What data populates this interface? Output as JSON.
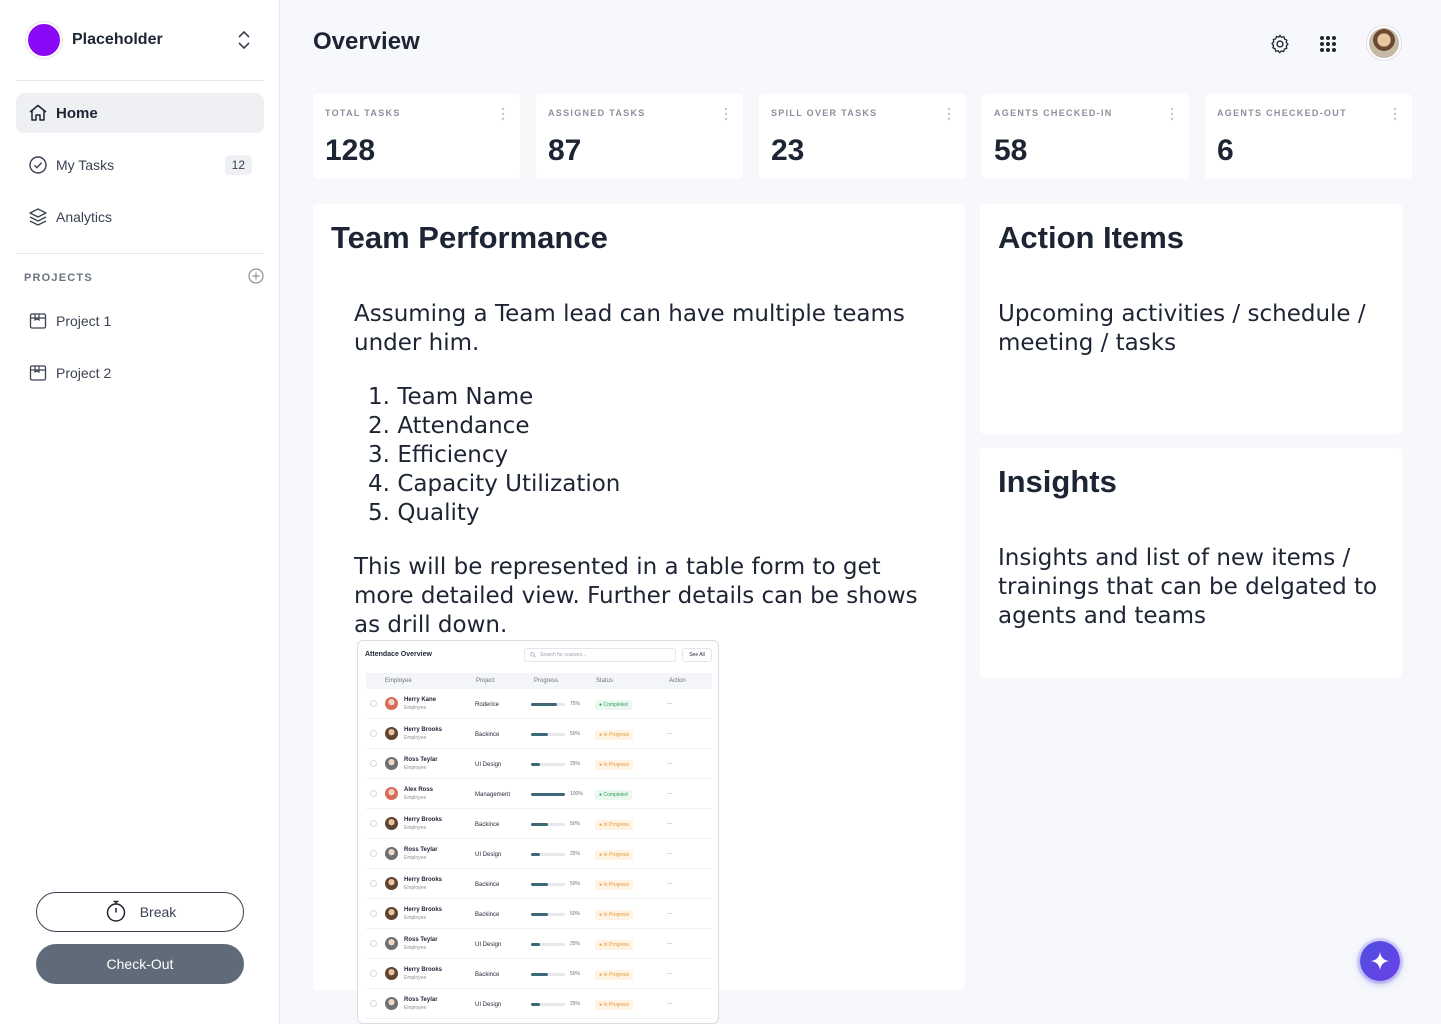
{
  "workspace": {
    "name": "Placeholder",
    "color": "#8a09f6"
  },
  "sidebar": {
    "nav": [
      {
        "label": "Home",
        "icon": "home-icon",
        "active": true
      },
      {
        "label": "My Tasks",
        "icon": "check-circle-icon",
        "badge": "12"
      },
      {
        "label": "Analytics",
        "icon": "layers-icon"
      }
    ],
    "projects_title": "PROJECTS",
    "projects": [
      {
        "label": "Project 1"
      },
      {
        "label": "Project 2"
      }
    ],
    "break_label": "Break",
    "checkout_label": "Check-Out"
  },
  "header": {
    "title": "Overview"
  },
  "stats": [
    {
      "label": "TOTAL TASKS",
      "value": "128"
    },
    {
      "label": "ASSIGNED TASKS",
      "value": "87"
    },
    {
      "label": "SPILL OVER TASKS",
      "value": "23"
    },
    {
      "label": "AGENTS CHECKED-IN",
      "value": "58"
    },
    {
      "label": "AGENTS CHECKED-OUT",
      "value": "6"
    }
  ],
  "team_performance": {
    "title": "Team Performance",
    "intro": "Assuming a Team lead can have multiple teams under him.",
    "items": [
      "Team Name",
      "Attendance",
      "Efficiency",
      "Capacity Utilization",
      "Quality"
    ],
    "outro": "This will be represented in a table form to get more detailed view. Further details can be shows as drill down."
  },
  "action_items": {
    "title": "Action Items",
    "body": "Upcoming activities / schedule / meeting / tasks"
  },
  "insights": {
    "title": "Insights",
    "body": "Insights and list of new items / trainings that can be delgated to agents and teams"
  },
  "attendance_table": {
    "title": "Attendace Overview",
    "search_placeholder": "Search for courses...",
    "see_all": "See All",
    "columns": [
      "Employee",
      "Project",
      "Progress",
      "Status",
      "Action"
    ],
    "rows": [
      {
        "name": "Herry Kane",
        "role": "Employee",
        "project": "Roderice",
        "progress": 75,
        "pct": "75%",
        "status": "Completed",
        "state": "done"
      },
      {
        "name": "Herry Brooks",
        "role": "Employee",
        "project": "Backince",
        "progress": 50,
        "pct": "50%",
        "status": "In Progress",
        "state": "prog"
      },
      {
        "name": "Ross Teylar",
        "role": "Employee",
        "project": "UI Design",
        "progress": 25,
        "pct": "25%",
        "status": "In Progress",
        "state": "prog"
      },
      {
        "name": "Alex Ross",
        "role": "Employee",
        "project": "Management",
        "progress": 100,
        "pct": "100%",
        "status": "Completed",
        "state": "done"
      },
      {
        "name": "Herry Brooks",
        "role": "Employee",
        "project": "Backince",
        "progress": 50,
        "pct": "50%",
        "status": "In Progress",
        "state": "prog"
      },
      {
        "name": "Ross Teylar",
        "role": "Employee",
        "project": "UI Design",
        "progress": 25,
        "pct": "25%",
        "status": "In Progress",
        "state": "prog"
      },
      {
        "name": "Herry Brooks",
        "role": "Employee",
        "project": "Backince",
        "progress": 50,
        "pct": "50%",
        "status": "In Progress",
        "state": "prog"
      },
      {
        "name": "Herry Brooks",
        "role": "Employee",
        "project": "Backince",
        "progress": 50,
        "pct": "50%",
        "status": "In Progress",
        "state": "prog"
      },
      {
        "name": "Ross Teylar",
        "role": "Employee",
        "project": "UI Design",
        "progress": 25,
        "pct": "25%",
        "status": "In Progress",
        "state": "prog"
      },
      {
        "name": "Herry Brooks",
        "role": "Employee",
        "project": "Backince",
        "progress": 50,
        "pct": "50%",
        "status": "In Progress",
        "state": "prog"
      },
      {
        "name": "Ross Teylar",
        "role": "Employee",
        "project": "UI Design",
        "progress": 25,
        "pct": "25%",
        "status": "In Progress",
        "state": "prog"
      }
    ],
    "action_glyph": "..."
  },
  "colors": {
    "accent": "#5f6b78",
    "fab": "#5b47e4",
    "progress": "#3d6a78"
  }
}
